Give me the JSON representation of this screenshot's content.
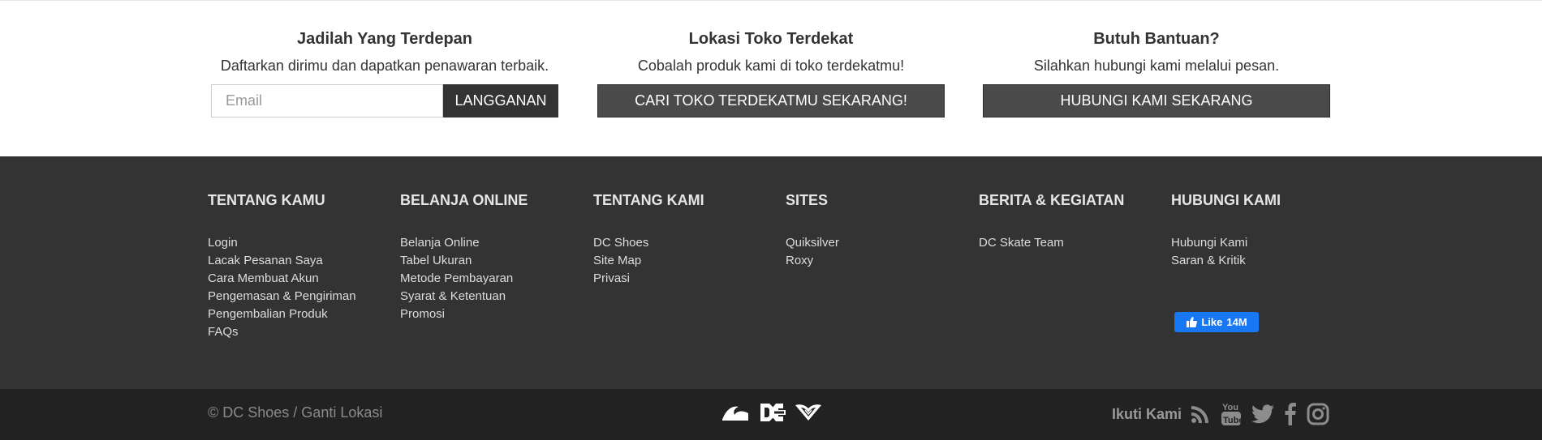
{
  "top": {
    "newsletter": {
      "title": "Jadilah Yang Terdepan",
      "subtitle": "Daftarkan dirimu dan dapatkan penawaran terbaik.",
      "email_placeholder": "Email",
      "button": "LANGGANAN"
    },
    "stores": {
      "title": "Lokasi Toko Terdekat",
      "subtitle": "Cobalah produk kami di toko terdekatmu!",
      "button": "CARI TOKO TERDEKATMU SEKARANG!"
    },
    "help": {
      "title": "Butuh Bantuan?",
      "subtitle": "Silahkan hubungi kami melalui pesan.",
      "button": "HUBUNGI KAMI SEKARANG"
    }
  },
  "footer": {
    "columns": [
      {
        "title": "TENTANG KAMU",
        "links": [
          "Login",
          "Lacak Pesanan Saya",
          "Cara Membuat Akun",
          "Pengemasan & Pengiriman",
          "Pengembalian Produk",
          "FAQs"
        ]
      },
      {
        "title": "BELANJA ONLINE",
        "links": [
          "Belanja Online",
          "Tabel Ukuran",
          "Metode Pembayaran",
          "Syarat & Ketentuan",
          "Promosi"
        ]
      },
      {
        "title": "TENTANG KAMI",
        "links": [
          "DC Shoes",
          "Site Map",
          "Privasi"
        ]
      },
      {
        "title": "SITES",
        "links": [
          "Quiksilver",
          "Roxy"
        ]
      },
      {
        "title": "BERITA & KEGIATAN",
        "links": [
          "DC Skate Team"
        ]
      },
      {
        "title": "HUBUNGI KAMI",
        "links": [
          "Hubungi Kami",
          "Saran & Kritik"
        ]
      }
    ],
    "facebook_like": {
      "label": "Like",
      "count": "14M",
      "color": "#1877f2"
    }
  },
  "bottom": {
    "copyright": "© DC Shoes / Ganti Lokasi",
    "brands": [
      "quiksilver-logo",
      "dc-logo",
      "roxy-logo"
    ],
    "follow_label": "Ikuti Kami",
    "social": [
      "rss-icon",
      "youtube-icon",
      "twitter-icon",
      "facebook-icon",
      "instagram-icon"
    ]
  },
  "colors": {
    "footer_bg": "#333333",
    "bottom_bg": "#222222",
    "button_dark": "#333333"
  }
}
